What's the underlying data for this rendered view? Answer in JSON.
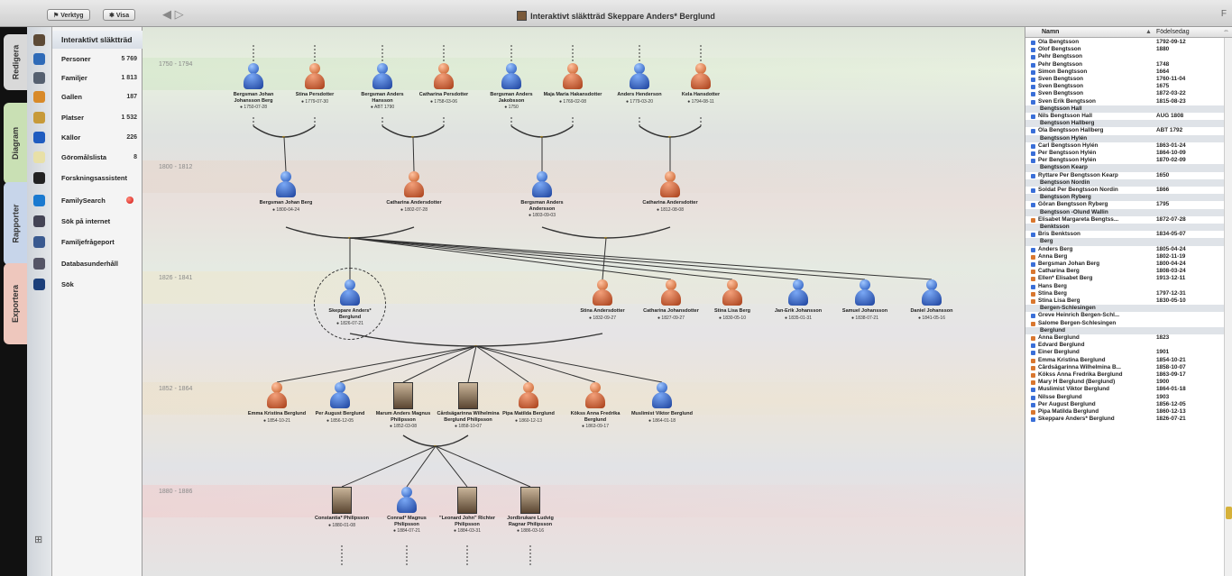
{
  "window": {
    "title": "Interaktivt släktträd Skeppare Anders* Berglund",
    "btn1": "Verktyg",
    "btn2": "Visa",
    "nav_back": "◀",
    "nav_fwd": "▷",
    "right_glyph": "F"
  },
  "vtabs": [
    {
      "label": "Redigera",
      "color": "#d9d9d9"
    },
    {
      "label": "Diagram",
      "color": "#c9e0b4"
    },
    {
      "label": "Rapporter",
      "color": "#c7d5ea"
    },
    {
      "label": "Exportera",
      "color": "#eec7bd"
    }
  ],
  "sidebar": {
    "items": [
      {
        "label": "Interaktivt släktträd",
        "count": ""
      },
      {
        "label": "Personer",
        "count": "5 769"
      },
      {
        "label": "Familjer",
        "count": "1 813"
      },
      {
        "label": "Gallen",
        "count": "187"
      },
      {
        "label": "Platser",
        "count": "1 532"
      },
      {
        "label": "Källor",
        "count": "226"
      },
      {
        "label": "Göromålslista",
        "count": "8"
      },
      {
        "label": "Forskningsassistent",
        "count": ""
      },
      {
        "label": "FamilySearch",
        "count": ""
      },
      {
        "label": "Sök på internet",
        "count": ""
      },
      {
        "label": "Familjefrågeport",
        "count": ""
      },
      {
        "label": "Databasunderhåll",
        "count": ""
      },
      {
        "label": "Sök",
        "count": ""
      }
    ],
    "icon_names": [
      "tree-icon",
      "persons-icon",
      "families-icon",
      "gallery-icon",
      "places-icon",
      "sources-icon",
      "todo-icon",
      "assistant-icon",
      "familysearch-icon",
      "web-search-icon",
      "question-icon",
      "database-icon",
      "search-icon"
    ],
    "add_glyph": "⊞"
  },
  "generations": [
    "1750 - 1794",
    "1800 - 1812",
    "1826 - 1841",
    "1852 - 1864",
    "1880 - 1886"
  ],
  "tree": {
    "gen1": [
      {
        "name": "Bergsman Johan Johansson Berg",
        "date": "● 1750-07-28",
        "sex": "male"
      },
      {
        "name": "Stina Persdotter",
        "date": "● 1779-07-30",
        "sex": "female"
      },
      {
        "name": "Bergsman Anders Hansson",
        "date": "● ABT 1790",
        "sex": "male"
      },
      {
        "name": "Catharina Persdotter",
        "date": "● 1758-03-06",
        "sex": "female"
      },
      {
        "name": "Bergsman Anders Jakobsson",
        "date": "● 1750",
        "sex": "male"
      },
      {
        "name": "Maja Maria Hakansdotter",
        "date": "● 1769-02-08",
        "sex": "female"
      },
      {
        "name": "Anders Henderson",
        "date": "● 1779-03-20",
        "sex": "male"
      },
      {
        "name": "Kela Hansdotter",
        "date": "● 1794-08-11",
        "sex": "female"
      }
    ],
    "gen2": [
      {
        "name": "Bergsman Johan Berg",
        "date": "● 1800-04-24",
        "sex": "male"
      },
      {
        "name": "Catharina Andersdotter",
        "date": "● 1802-07-28",
        "sex": "female"
      },
      {
        "name": "Bergsman Anders Andersson",
        "date": "● 1803-09-03",
        "sex": "male"
      },
      {
        "name": "Catharina Andersdotter",
        "date": "● 1812-08-08",
        "sex": "female"
      }
    ],
    "gen3": [
      {
        "name": "Skeppare Anders* Berglund",
        "date": "● 1826-07-21",
        "sex": "male"
      },
      {
        "name": "Stina Andersdotter",
        "date": "● 1832-09-27",
        "sex": "female"
      },
      {
        "name": "Catharina Johansdotter",
        "date": "● 1827-09-27",
        "sex": "female"
      },
      {
        "name": "Stina Lisa Berg",
        "date": "● 1830-05-10",
        "sex": "female"
      },
      {
        "name": "Jan-Erik Johansson",
        "date": "● 1835-01-31",
        "sex": "male"
      },
      {
        "name": "Samuel Johansson",
        "date": "● 1838-07-21",
        "sex": "male"
      },
      {
        "name": "Daniel Johansson",
        "date": "● 1841-05-16",
        "sex": "male"
      }
    ],
    "gen4": [
      {
        "name": "Emma Kristina Berglund",
        "date": "● 1854-10-21",
        "sex": "female"
      },
      {
        "name": "Per August Berglund",
        "date": "● 1856-12-05",
        "sex": "male"
      },
      {
        "name": "Marum Anders Magnus Philipsson",
        "date": "● 1852-03-08",
        "sex": "photo"
      },
      {
        "name": "Cårdsägarinna Wilhelmina Berglund Philipsson",
        "date": "● 1858-10-07",
        "sex": "photo"
      },
      {
        "name": "Pipa Matilda Berglund",
        "date": "● 1860-12-13",
        "sex": "female"
      },
      {
        "name": "Kökss Anna Fredrika Berglund",
        "date": "● 1863-09-17",
        "sex": "female"
      },
      {
        "name": "Muslimist Viktor Berglund",
        "date": "● 1864-01-18",
        "sex": "male"
      }
    ],
    "gen5": [
      {
        "name": "Constantia* Philipsson",
        "date": "● 1880-01-08",
        "sex": "photo"
      },
      {
        "name": "Conrad* Magnus Philipsson",
        "date": "● 1884-07-21",
        "sex": "male"
      },
      {
        "name": "\"Leonard John\" Richter Philipsson",
        "date": "● 1884-03-31",
        "sex": "photo"
      },
      {
        "name": "Jordbrukare Ludvig Ragnar Philipsson",
        "date": "● 1886-03-16",
        "sex": "photo"
      }
    ]
  },
  "right_panel": {
    "col_name": "Namn",
    "col_sort": "▲",
    "col_date": "Födelsedag",
    "col_menu": "⇔",
    "rows": [
      {
        "name": "Ola Bengtsson",
        "date": "1792-09-12",
        "c": "#3a6fd8"
      },
      {
        "name": "Olof Bengtsson",
        "date": "1880",
        "c": "#3a6fd8"
      },
      {
        "name": "Pehr Bengtsson",
        "date": "",
        "c": "#3a6fd8"
      },
      {
        "name": "Pehr Bengtsson",
        "date": "1748",
        "c": "#3a6fd8"
      },
      {
        "name": "Simon Bengtsson",
        "date": "1664",
        "c": "#3a6fd8"
      },
      {
        "name": "Sven Bengtsson",
        "date": "1760-11-04",
        "c": "#3a6fd8"
      },
      {
        "name": "Sven Bengtsson",
        "date": "1675",
        "c": "#3a6fd8"
      },
      {
        "name": "Sven Bengtsson",
        "date": "1872-03-22",
        "c": "#3a6fd8"
      },
      {
        "name": "Sven Erik Bengtsson",
        "date": "1815-08-23",
        "c": "#3a6fd8"
      },
      {
        "name": "Bengtsson Hall",
        "date": "",
        "g": true
      },
      {
        "name": "Nils Bengtsson Hall",
        "date": "AUG 1808",
        "c": "#3a6fd8"
      },
      {
        "name": "Bengtsson Hallberg",
        "date": "",
        "g": true
      },
      {
        "name": "Ola Bengtsson Hallberg",
        "date": "ABT 1792",
        "c": "#3a6fd8"
      },
      {
        "name": "Bengtsson Hylén",
        "date": "",
        "g": true
      },
      {
        "name": "Carl Bengtsson Hylén",
        "date": "1863-01-24",
        "c": "#3a6fd8"
      },
      {
        "name": "Per Bengtsson Hylén",
        "date": "1864-10-09",
        "c": "#3a6fd8"
      },
      {
        "name": "Per Bengtsson Hylén",
        "date": "1870-02-09",
        "c": "#3a6fd8"
      },
      {
        "name": "Bengtsson Kearp",
        "date": "",
        "g": true
      },
      {
        "name": "Ryttare Per Bengtsson Kearp",
        "date": "1650",
        "c": "#3a6fd8"
      },
      {
        "name": "Bengtsson Nordin",
        "date": "",
        "g": true
      },
      {
        "name": "Soldat Per Bengtsson Nordin",
        "date": "1866",
        "c": "#3a6fd8"
      },
      {
        "name": "Bengtsson Ryberg",
        "date": "",
        "g": true
      },
      {
        "name": "Göran Bengtsson Ryberg",
        "date": "1795",
        "c": "#3a6fd8"
      },
      {
        "name": "Bengtsson -Ölund Wallin",
        "date": "",
        "g": true
      },
      {
        "name": "Elisabet Margareta Bengtss...",
        "date": "1872-07-28",
        "c": "#d9772f"
      },
      {
        "name": "Benktsson",
        "date": "",
        "g": true
      },
      {
        "name": "Bris Benktsson",
        "date": "1834-05-07",
        "c": "#3a6fd8"
      },
      {
        "name": "Berg",
        "date": "",
        "g": true
      },
      {
        "name": "Anders Berg",
        "date": "1805-04-24",
        "c": "#3a6fd8"
      },
      {
        "name": "Anna Berg",
        "date": "1802-11-19",
        "c": "#d9772f"
      },
      {
        "name": "Bergsman Johan Berg",
        "date": "1800-04-24",
        "c": "#3a6fd8"
      },
      {
        "name": "Catharina Berg",
        "date": "1808-03-24",
        "c": "#d9772f"
      },
      {
        "name": "Ellen* Elisabet Berg",
        "date": "1913-12-11",
        "c": "#d9772f"
      },
      {
        "name": "Hans Berg",
        "date": "",
        "c": "#3a6fd8"
      },
      {
        "name": "Stina Berg",
        "date": "1797-12-31",
        "c": "#d9772f"
      },
      {
        "name": "Stina Lisa Berg",
        "date": "1830-05-10",
        "c": "#d9772f"
      },
      {
        "name": "Bergen-Schlesingen",
        "date": "",
        "g": true
      },
      {
        "name": "Greve Heinrich Bergen-Schl...",
        "date": "",
        "c": "#3a6fd8"
      },
      {
        "name": "Salome Bergen-Schlesingen",
        "date": "",
        "c": "#d9772f"
      },
      {
        "name": "Berglund",
        "date": "",
        "g": true
      },
      {
        "name": "Anna Berglund",
        "date": "1823",
        "c": "#d9772f"
      },
      {
        "name": "Edvard Berglund",
        "date": "",
        "c": "#3a6fd8"
      },
      {
        "name": "Einer Berglund",
        "date": "1901",
        "c": "#3a6fd8"
      },
      {
        "name": "Emma Kristina Berglund",
        "date": "1854-10-21",
        "c": "#d9772f"
      },
      {
        "name": "Cårdsägarinna Wilhelmina B...",
        "date": "1858-10-07",
        "c": "#d9772f"
      },
      {
        "name": "Kökss Anna Fredrika Berglund",
        "date": "1863-09-17",
        "c": "#d9772f"
      },
      {
        "name": "Mary H Berglund (Berglund)",
        "date": "1900",
        "c": "#d9772f"
      },
      {
        "name": "Muslimist Viktor Berglund",
        "date": "1864-01-18",
        "c": "#3a6fd8"
      },
      {
        "name": "Nilsse Berglund",
        "date": "1903",
        "c": "#3a6fd8"
      },
      {
        "name": "Per August Berglund",
        "date": "1856-12-05",
        "c": "#3a6fd8"
      },
      {
        "name": "Pipa Matilda Berglund",
        "date": "1860-12-13",
        "c": "#d9772f"
      },
      {
        "name": "Skeppare Anders* Berglund",
        "date": "1826-07-21",
        "c": "#3a6fd8"
      }
    ]
  }
}
